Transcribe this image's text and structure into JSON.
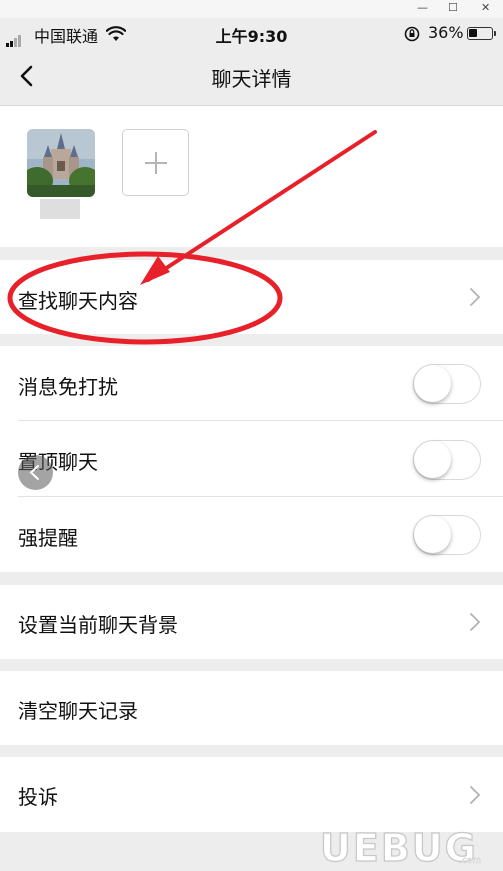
{
  "window_controls": {
    "minimize": "—",
    "maximize": "☐",
    "close": "✕"
  },
  "status_bar": {
    "carrier": "中国联通",
    "time": "上午9:30",
    "battery_pct": "36%",
    "battery_level": 0.36
  },
  "navbar": {
    "title": "聊天详情",
    "back_icon": "chevron-left-icon"
  },
  "members": {
    "add_icon": "plus-icon"
  },
  "rows": {
    "find_chat": {
      "label": "查找聊天内容"
    },
    "mute": {
      "label": "消息免打扰",
      "on": false
    },
    "pin": {
      "label": "置顶聊天",
      "on": false
    },
    "strong_remind": {
      "label": "强提醒",
      "on": false
    },
    "set_background": {
      "label": "设置当前聊天背景"
    },
    "clear_history": {
      "label": "清空聊天记录"
    },
    "complain": {
      "label": "投诉"
    }
  },
  "annotation": {
    "color": "#e8202a"
  },
  "watermark": {
    "text": "UEBUG",
    "sub": ".com"
  }
}
